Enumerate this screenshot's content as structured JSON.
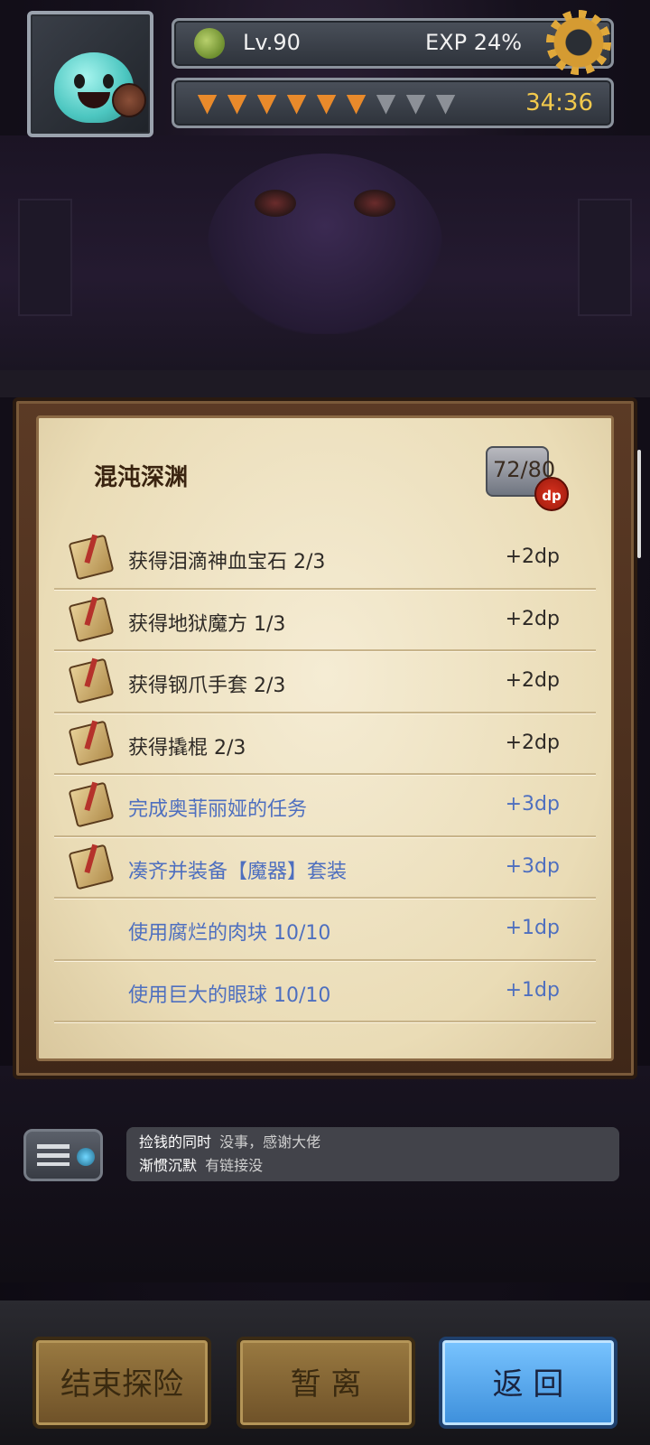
{
  "hud": {
    "level": "Lv.90",
    "exp": "EXP 24%",
    "stamina": {
      "full": 6,
      "total": 9
    },
    "timer": "34:36"
  },
  "panel": {
    "title": "混沌深渊",
    "dp_count": "72/80",
    "dp_badge": "dp"
  },
  "quests": [
    {
      "label": "获得泪滴神血宝石 2/3",
      "reward": "+2dp",
      "status": "done",
      "icon": "scroll-quill-icon"
    },
    {
      "label": "获得地狱魔方 1/3",
      "reward": "+2dp",
      "status": "done",
      "icon": "scroll-quill-icon"
    },
    {
      "label": "获得钢爪手套 2/3",
      "reward": "+2dp",
      "status": "done",
      "icon": "scroll-quill-icon"
    },
    {
      "label": "获得撬棍 2/3",
      "reward": "+2dp",
      "status": "done",
      "icon": "scroll-quill-icon"
    },
    {
      "label": "完成奥菲丽娅的任务",
      "reward": "+3dp",
      "status": "todo",
      "icon": "scroll-quill-icon"
    },
    {
      "label": "凑齐并装备【魔器】套装",
      "reward": "+3dp",
      "status": "todo",
      "icon": "scroll-quill-icon"
    },
    {
      "label": "使用腐烂的肉块 10/10",
      "reward": "+1dp",
      "status": "todo",
      "icon": ""
    },
    {
      "label": "使用巨大的眼球 10/10",
      "reward": "+1dp",
      "status": "todo",
      "icon": ""
    }
  ],
  "chat": [
    {
      "name": "捡钱的同时",
      "message": "没事，感谢大佬"
    },
    {
      "name": "渐惯沉默",
      "message": "有链接没"
    }
  ],
  "buttons": {
    "end": "结束探险",
    "pause": "暂 离",
    "back": "返 回"
  },
  "colors": {
    "done_text": "#2e2a26",
    "todo_text": "#4e6fbf",
    "timer": "#f2c94c",
    "back_button": "#3d8fdb"
  }
}
